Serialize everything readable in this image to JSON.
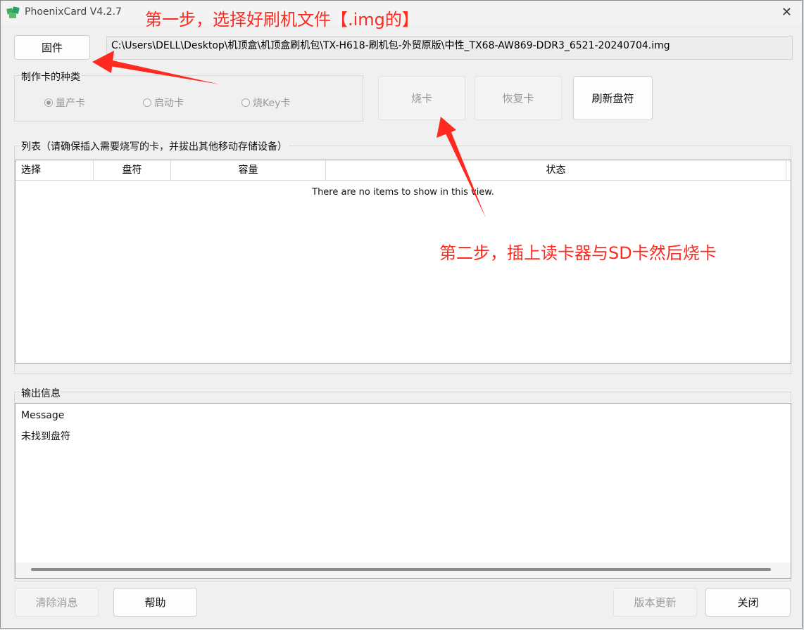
{
  "window": {
    "title": "PhoenixCard V4.2.7"
  },
  "firmware": {
    "button_label": "固件",
    "path": "C:\\Users\\DELL\\Desktop\\机顶盒\\机顶盒刷机包\\TX-H618-刷机包-外贸原版\\中性_TX68-AW869-DDR3_6521-20240704.img"
  },
  "card_type": {
    "label": "制作卡的种类",
    "options": [
      {
        "label": "量产卡",
        "selected": true
      },
      {
        "label": "启动卡",
        "selected": false
      },
      {
        "label": "烧Key卡",
        "selected": false
      }
    ]
  },
  "actions": {
    "burn": "烧卡",
    "restore": "恢复卡",
    "refresh": "刷新盘符"
  },
  "list": {
    "label": "列表（请确保插入需要烧写的卡，并拔出其他移动存储设备）",
    "columns": [
      "选择",
      "盘符",
      "容量",
      "状态"
    ],
    "empty_text": "There are no items to show in this view."
  },
  "output": {
    "label": "输出信息",
    "lines": [
      "Message",
      "未找到盘符"
    ]
  },
  "footer": {
    "clear": "清除消息",
    "help": "帮助",
    "update": "版本更新",
    "close": "关闭"
  },
  "annotations": {
    "step1": "第一步，选择好刷机文件【.img的】",
    "step2": "第二步，插上读卡器与SD卡然后烧卡",
    "color": "#ff2a1f"
  }
}
